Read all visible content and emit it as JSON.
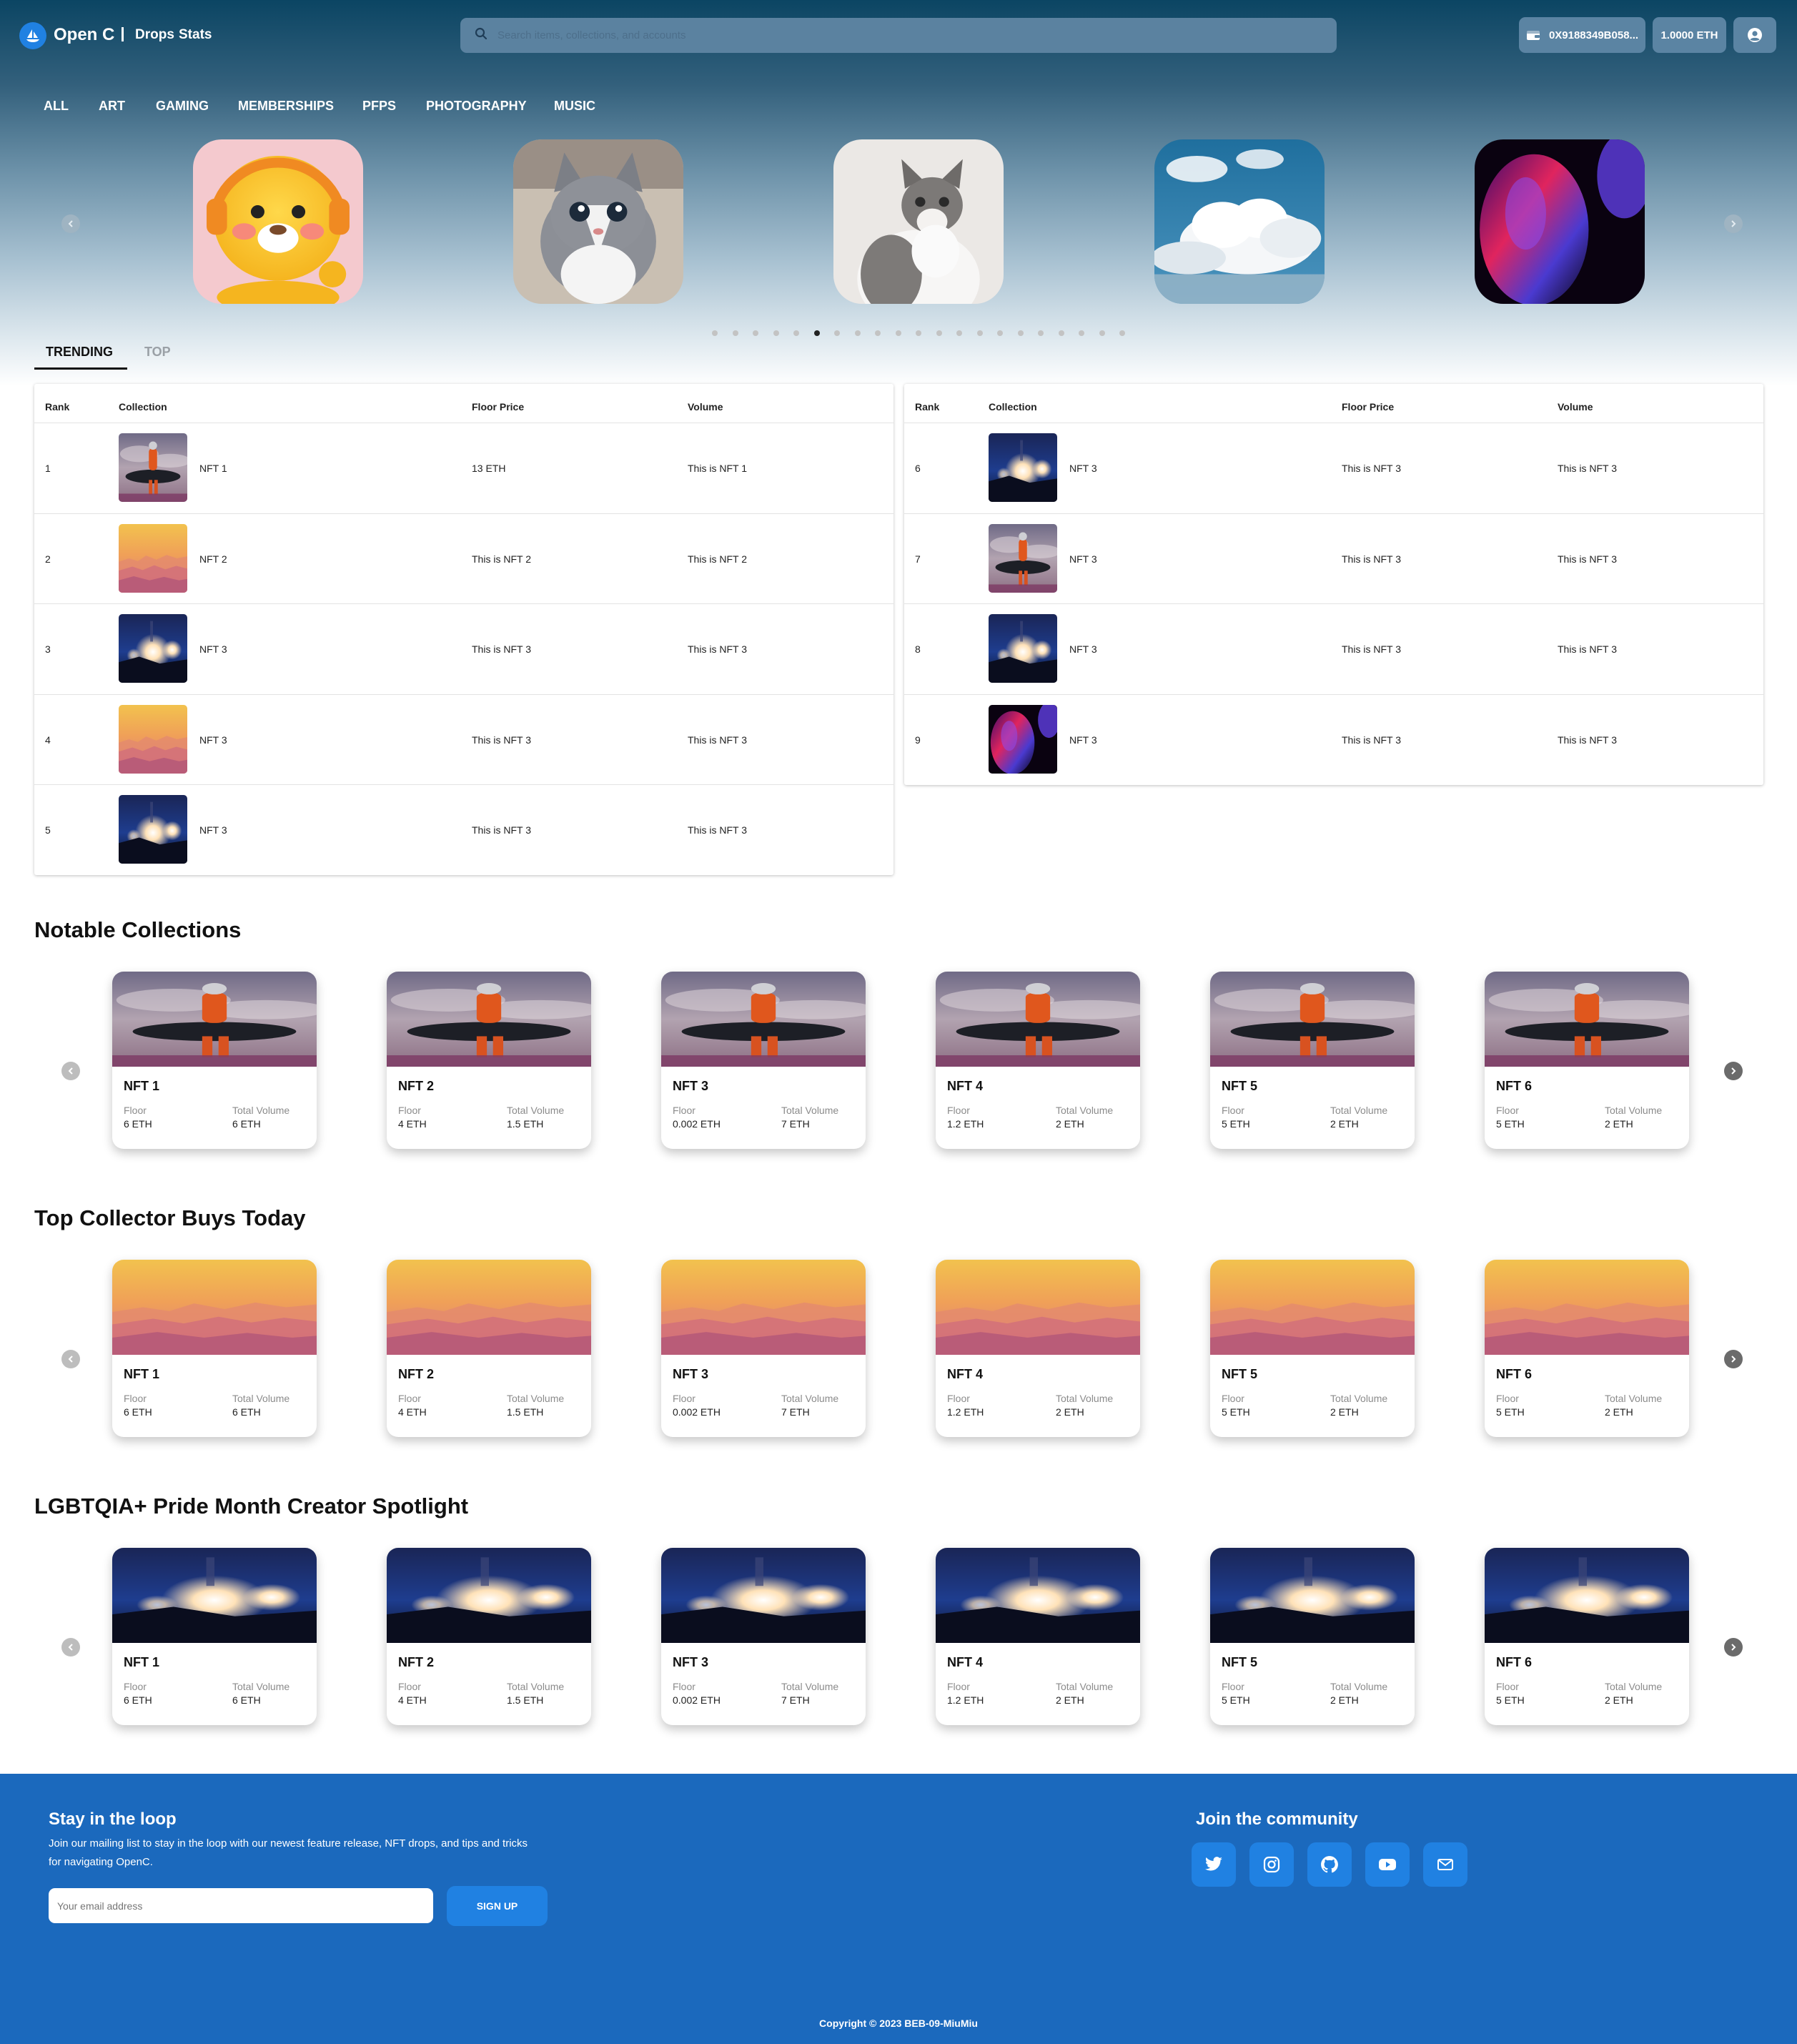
{
  "header": {
    "brand": "Open C",
    "links": [
      "Drops",
      "Stats"
    ],
    "search_placeholder": "Search items, collections, and accounts",
    "wallet_address": "0X9188349B058...",
    "balance": "1.0000 ETH"
  },
  "categories": [
    "ALL",
    "ART",
    "GAMING",
    "MEMBERSHIPS",
    "PFPS",
    "PHOTOGRAPHY",
    "MUSIC"
  ],
  "carousel": {
    "slides": [
      "yellow-bear-toy",
      "kitten",
      "cat-looking-up",
      "clouds",
      "abstract-purple"
    ],
    "dots": 21,
    "active_dot": 5
  },
  "tabs": {
    "trending": "TRENDING",
    "top": "TOP"
  },
  "table": {
    "headers": {
      "rank": "Rank",
      "collection": "Collection",
      "floor": "Floor Price",
      "volume": "Volume"
    },
    "left_rows": [
      {
        "rank": "1",
        "name": "NFT 1",
        "floor": "13 ETH",
        "volume": "This is NFT 1",
        "img": "astronaut"
      },
      {
        "rank": "2",
        "name": "NFT 2",
        "floor": "This is NFT 2",
        "volume": "This is NFT 2",
        "img": "sunset"
      },
      {
        "rank": "3",
        "name": "NFT 3",
        "floor": "This is NFT 3",
        "volume": "This is NFT 3",
        "img": "night"
      },
      {
        "rank": "4",
        "name": "NFT 3",
        "floor": "This is NFT 3",
        "volume": "This is NFT 3",
        "img": "sunset"
      },
      {
        "rank": "5",
        "name": "NFT 3",
        "floor": "This is NFT 3",
        "volume": "This is NFT 3",
        "img": "night"
      }
    ],
    "right_rows": [
      {
        "rank": "6",
        "name": "NFT 3",
        "floor": "This is NFT 3",
        "volume": "This is NFT 3",
        "img": "night"
      },
      {
        "rank": "7",
        "name": "NFT 3",
        "floor": "This is NFT 3",
        "volume": "This is NFT 3",
        "img": "astronaut"
      },
      {
        "rank": "8",
        "name": "NFT 3",
        "floor": "This is NFT 3",
        "volume": "This is NFT 3",
        "img": "night"
      },
      {
        "rank": "9",
        "name": "NFT 3",
        "floor": "This is NFT 3",
        "volume": "This is NFT 3",
        "img": "abstract"
      }
    ]
  },
  "sections": [
    {
      "title": "Notable Collections",
      "img": "astronaut"
    },
    {
      "title": "Top Collector Buys Today",
      "img": "sunset"
    },
    {
      "title": "LGBTQIA+ Pride Month Creator Spotlight",
      "img": "night"
    }
  ],
  "card_labels": {
    "floor": "Floor",
    "volume": "Total Volume"
  },
  "cards": [
    {
      "name": "NFT 1",
      "floor": "6 ETH",
      "volume": "6 ETH"
    },
    {
      "name": "NFT 2",
      "floor": "4 ETH",
      "volume": "1.5 ETH"
    },
    {
      "name": "NFT 3",
      "floor": "0.002 ETH",
      "volume": "7 ETH"
    },
    {
      "name": "NFT 4",
      "floor": "1.2 ETH",
      "volume": "2 ETH"
    },
    {
      "name": "NFT 5",
      "floor": "5 ETH",
      "volume": "2 ETH"
    },
    {
      "name": "NFT 6",
      "floor": "5 ETH",
      "volume": "2 ETH"
    }
  ],
  "footer": {
    "loop_title": "Stay in the loop",
    "loop_text_1": "Join our mailing list to stay in the loop with our newest feature release, NFT drops, and tips and tricks",
    "loop_text_2": "for navigating OpenC.",
    "email_placeholder": "Your email address",
    "signup": "SIGN UP",
    "community_title": "Join the community",
    "social_icons": [
      "twitter-icon",
      "instagram-icon",
      "github-icon",
      "youtube-icon",
      "mail-icon"
    ],
    "copyright": "Copyright © 2023 BEB-09-MiuMiu"
  },
  "colors": {
    "accent": "#2081e2",
    "footer_bg": "#1b69bd",
    "hero_top": "#0b4563"
  }
}
